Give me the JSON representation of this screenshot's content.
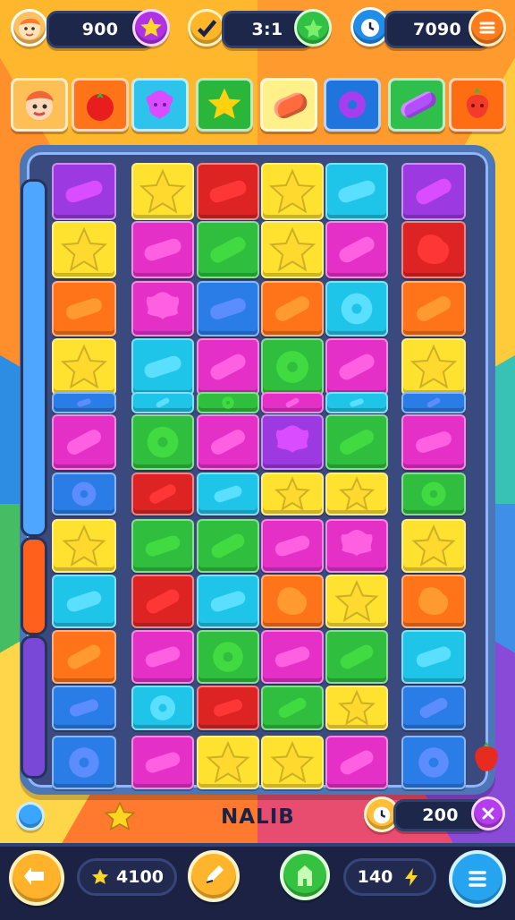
{
  "hud": {
    "player_score": "900",
    "moves": "3:1",
    "coins": "7090",
    "bottom_title": "NALIB",
    "bottom_right": "200",
    "bottom_stars": "4100",
    "bottom_lives": "140"
  },
  "icons": {
    "avatar": "player-avatar",
    "star": "star-icon",
    "check": "check-icon",
    "clock": "timer-icon",
    "menu": "menu-icon",
    "back": "back-arrow-icon",
    "edit": "pencil-icon",
    "shop": "house-icon",
    "hamburger": "list-icon"
  },
  "colors": {
    "purple": "#9d39e0",
    "yellow": "#ffe22f",
    "red": "#de2323",
    "green": "#2fbe3e",
    "cyan": "#1fc5e8",
    "orange": "#ff7418",
    "magenta": "#e530c8",
    "blue": "#2a7ce6",
    "pink": "#ff7bd5"
  },
  "top_pieces": [
    {
      "name": "avatar",
      "bg": "#ffb544",
      "fg": "#ff6a3d"
    },
    {
      "name": "tomato",
      "bg": "#ff7a18",
      "fg": "#e81e1e"
    },
    {
      "name": "flower",
      "bg": "#2dc3ed",
      "fg": "#d74dff"
    },
    {
      "name": "star",
      "bg": "#2ab63a",
      "fg": "#ffd20f"
    },
    {
      "name": "jelly",
      "bg": "#fff08a",
      "fg": "#ff6b3d"
    },
    {
      "name": "ring",
      "bg": "#1f74de",
      "fg": "#a83df0"
    },
    {
      "name": "bean",
      "bg": "#2ec04a",
      "fg": "#b250ff"
    },
    {
      "name": "strawberry",
      "bg": "#ff6d12",
      "fg": "#f33b2b"
    }
  ],
  "grid": [
    [
      "purple",
      "yellow",
      "red",
      "yellow",
      "cyan",
      "purple"
    ],
    [
      "yellow",
      "magenta",
      "green",
      "yellow",
      "magenta",
      "red"
    ],
    [
      "orange",
      "magenta",
      "blue",
      "orange",
      "cyan",
      "orange"
    ],
    [
      "yellow",
      "cyan",
      "magenta",
      "green",
      "magenta",
      "yellow"
    ],
    [
      "blue",
      "cyan",
      "green",
      "magenta",
      "cyan",
      "blue"
    ],
    [
      "magenta",
      "green",
      "magenta",
      "purple",
      "green",
      "magenta"
    ],
    [
      "blue",
      "red",
      "cyan",
      "yellow",
      "yellow",
      "green"
    ],
    [
      "yellow",
      "green",
      "green",
      "magenta",
      "magenta",
      "yellow"
    ],
    [
      "cyan",
      "red",
      "cyan",
      "orange",
      "yellow",
      "orange"
    ],
    [
      "orange",
      "magenta",
      "green",
      "magenta",
      "green",
      "cyan"
    ],
    [
      "blue",
      "cyan",
      "red",
      "green",
      "yellow",
      "blue"
    ],
    [
      "blue",
      "magenta",
      "yellow",
      "yellow",
      "magenta",
      "blue"
    ]
  ]
}
